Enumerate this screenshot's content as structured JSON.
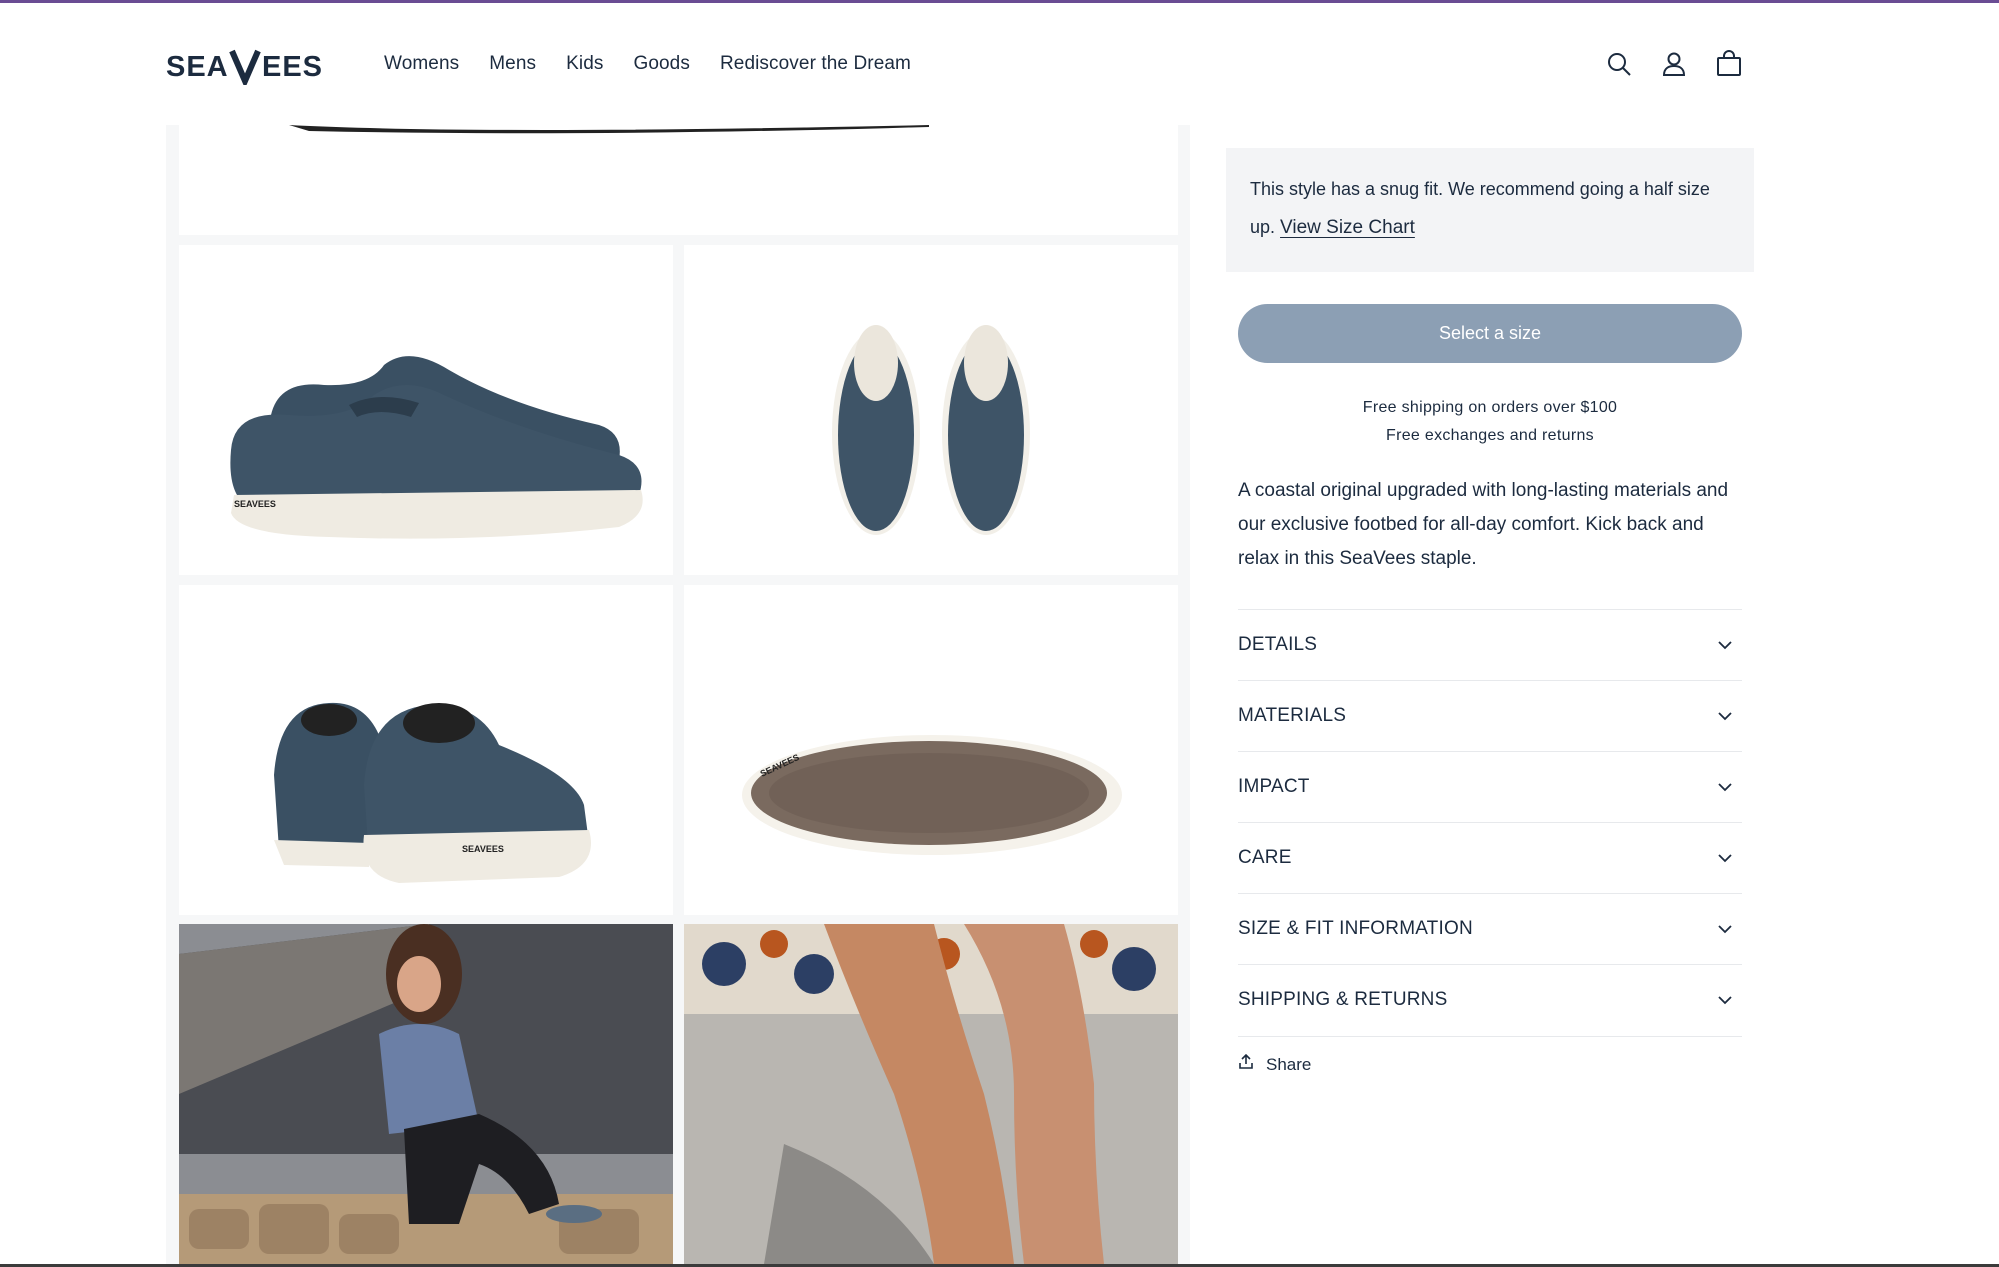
{
  "brand": {
    "logo_text": "SEAVEES"
  },
  "nav": {
    "items": [
      "Womens",
      "Mens",
      "Kids",
      "Goods",
      "Rediscover the Dream"
    ]
  },
  "header_icons": [
    "search-icon",
    "account-icon",
    "cart-icon"
  ],
  "fit_note": {
    "text": "This style has a snug fit. We recommend going a half size up.",
    "link": "View Size Chart"
  },
  "cta": {
    "label": "Select a size"
  },
  "shipping": {
    "line1": "Free shipping on orders over $100",
    "line2": "Free exchanges and returns"
  },
  "description": "A coastal original upgraded with long-lasting materials and our exclusive footbed for all-day comfort. Kick back and relax in this SeaVees staple.",
  "accordion": [
    {
      "label": "DETAILS"
    },
    {
      "label": "MATERIALS"
    },
    {
      "label": "IMPACT"
    },
    {
      "label": "CARE"
    },
    {
      "label": "SIZE & FIT INFORMATION"
    },
    {
      "label": "SHIPPING & RETURNS"
    }
  ],
  "share": {
    "label": "Share"
  },
  "colors": {
    "navy": "#1c2b3f",
    "shoe": "#3e5467",
    "cta": "#8c9fb4",
    "accent_top": "#6a4c93"
  }
}
